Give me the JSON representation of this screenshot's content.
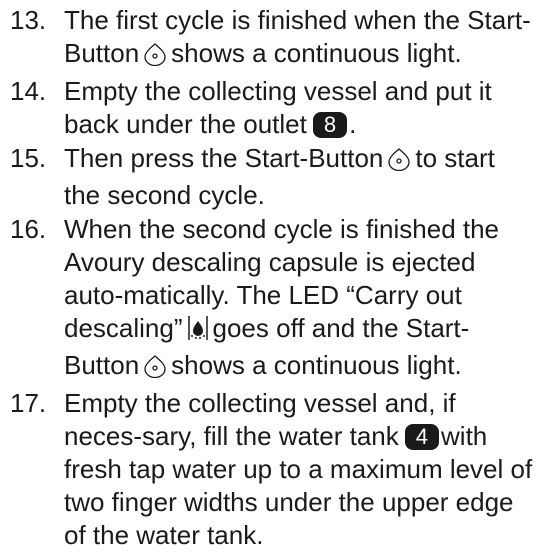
{
  "steps": [
    {
      "number": "13.",
      "text_a": "The first cycle is finished when the Start-Button",
      "icon_a": "start-button-icon",
      "text_b": "shows a continuous light."
    },
    {
      "number": "14.",
      "text_a": "Empty the collecting vessel and put it back under the outlet",
      "badge": "8",
      "text_b": "."
    },
    {
      "number": "15.",
      "text_a": "Then press the Start-Button",
      "icon_a": "start-button-icon",
      "text_b": "to start the second cycle."
    },
    {
      "number": "16.",
      "text_a": "When the second cycle is finished the Avoury descaling capsule is ejected auto-matically. The LED “Carry out descaling”",
      "icon_a": "descaling-led-icon",
      "text_b": "goes off and the Start-Button",
      "icon_b": "start-button-icon",
      "text_c": "shows a continuous light."
    },
    {
      "number": "17.",
      "text_a": "Empty the collecting vessel and, if neces-sary, fill the water tank",
      "badge": "4",
      "text_b": "with fresh tap water up to a maximum level of two finger widths under the upper edge of the water tank."
    }
  ]
}
